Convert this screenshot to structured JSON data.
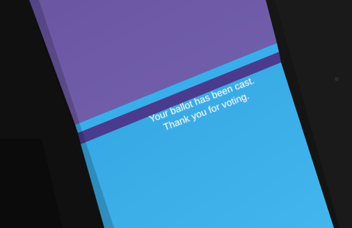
{
  "screen": {
    "message_line_1": "Your ballot has been cast.",
    "message_line_2": "Thank you for voting.",
    "colors": {
      "header": "#6f5aa6",
      "stripe_light": "#35a9e6",
      "stripe_dark": "#4a3a8c",
      "body": "#3fb0ea",
      "bezel": "#161616"
    }
  }
}
